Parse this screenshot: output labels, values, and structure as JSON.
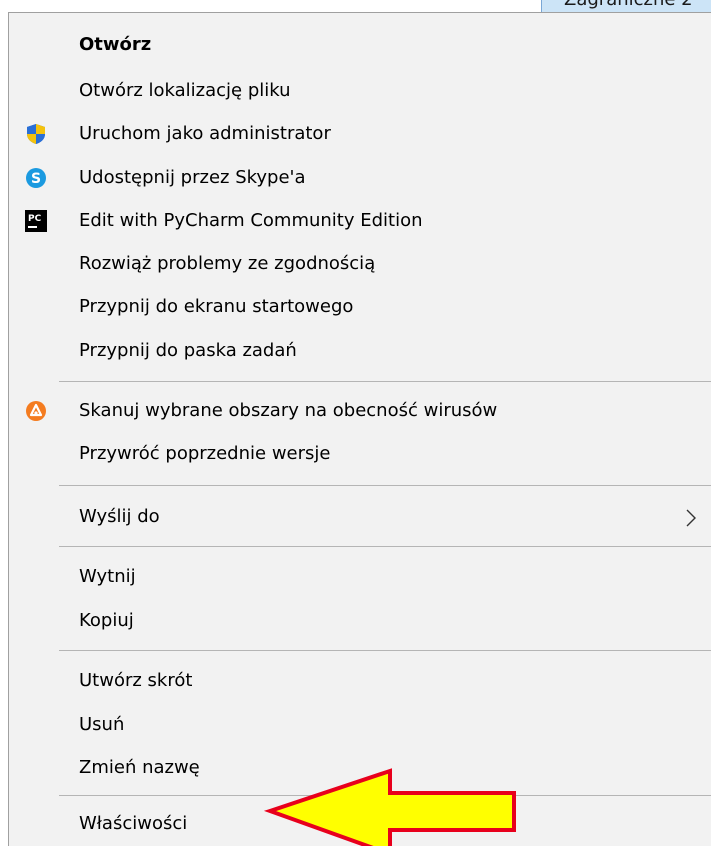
{
  "background_tab": {
    "label": "Zagraniczne 2"
  },
  "context_menu": {
    "items": [
      {
        "label": "Otwórz",
        "bold": true,
        "icon": ""
      },
      {
        "label": "Otwórz lokalizację pliku",
        "icon": ""
      },
      {
        "label": "Uruchom jako administrator",
        "icon": "uac-shield-icon"
      },
      {
        "label": "Udostępnij przez Skype'a",
        "icon": "skype-icon"
      },
      {
        "label": "Edit with PyCharm Community Edition",
        "icon": "pycharm-icon"
      },
      {
        "label": "Rozwiąż problemy ze zgodnością",
        "icon": ""
      },
      {
        "label": "Przypnij do ekranu startowego",
        "icon": ""
      },
      {
        "label": "Przypnij do paska zadań",
        "icon": ""
      },
      {
        "label": "Skanuj wybrane obszary na obecność wirusów",
        "icon": "avast-icon"
      },
      {
        "label": "Przywróć poprzednie wersje",
        "icon": ""
      },
      {
        "label": "Wyślij do",
        "icon": "",
        "submenu": true
      },
      {
        "label": "Wytnij",
        "icon": ""
      },
      {
        "label": "Kopiuj",
        "icon": ""
      },
      {
        "label": "Utwórz skrót",
        "icon": ""
      },
      {
        "label": "Usuń",
        "icon": ""
      },
      {
        "label": "Zmień nazwę",
        "icon": ""
      },
      {
        "label": "Właściwości",
        "icon": ""
      }
    ]
  },
  "annotation": {
    "icon": "yellow-arrow-icon",
    "fill_color": "#ffff00",
    "stroke_color": "#e8001c"
  },
  "colors": {
    "menu_background": "#f2f2f2",
    "separator": "#b5b5b5",
    "text": "#000000"
  }
}
